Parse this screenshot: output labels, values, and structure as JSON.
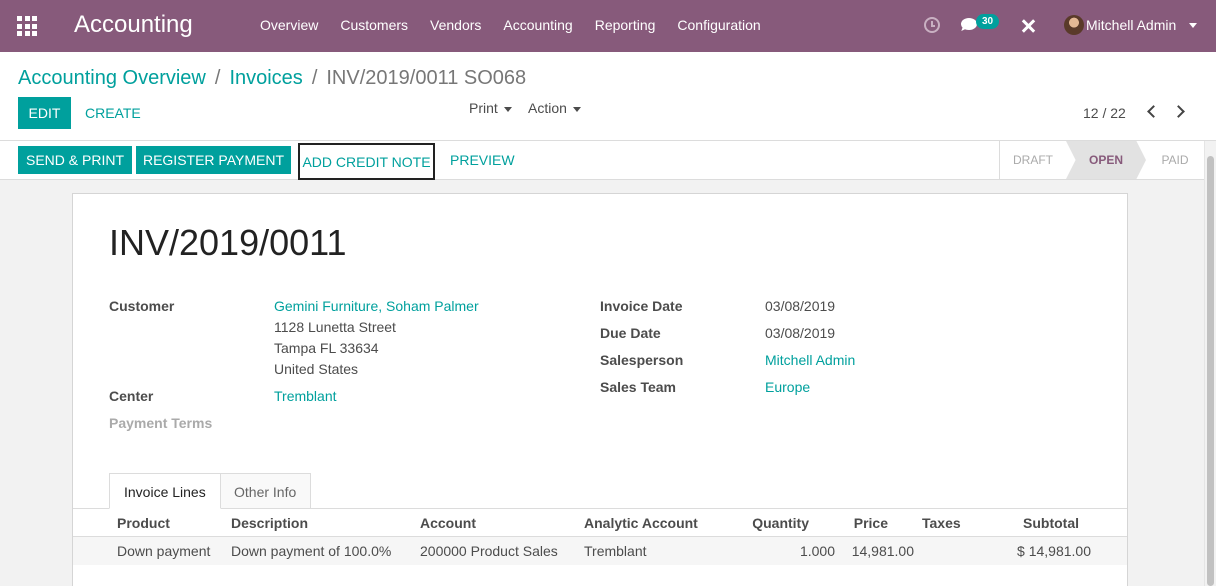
{
  "navbar": {
    "app_title": "Accounting",
    "menu": [
      "Overview",
      "Customers",
      "Vendors",
      "Accounting",
      "Reporting",
      "Configuration"
    ],
    "chat_count": "30",
    "user": "Mitchell Admin",
    "brand_color": "#875a7b",
    "accent_color": "#00a09d"
  },
  "breadcrumb": {
    "root": "Accounting Overview",
    "parent": "Invoices",
    "current": "INV/2019/0011 SO068",
    "separator": "/"
  },
  "toolbar": {
    "edit_label": "EDIT",
    "create_label": "CREATE",
    "print_label": "Print",
    "action_label": "Action",
    "pager": "12 / 22"
  },
  "statusbar": {
    "send_print": "SEND & PRINT",
    "register_payment": "REGISTER PAYMENT",
    "add_credit_note": "ADD CREDIT NOTE",
    "preview": "PREVIEW",
    "stages": [
      "DRAFT",
      "OPEN",
      "PAID"
    ],
    "active_stage": "OPEN"
  },
  "invoice": {
    "number": "INV/2019/0011",
    "customer_label": "Customer",
    "customer_name": "Gemini Furniture, Soham Palmer",
    "address": [
      "1128 Lunetta Street",
      "Tampa FL 33634",
      "United States"
    ],
    "center_label": "Center",
    "center": "Tremblant",
    "payment_terms_label": "Payment Terms",
    "invoice_date_label": "Invoice Date",
    "invoice_date": "03/08/2019",
    "due_date_label": "Due Date",
    "due_date": "03/08/2019",
    "salesperson_label": "Salesperson",
    "salesperson": "Mitchell Admin",
    "sales_team_label": "Sales Team",
    "sales_team": "Europe"
  },
  "tabs": [
    "Invoice Lines",
    "Other Info"
  ],
  "lines": {
    "headers": [
      "Product",
      "Description",
      "Account",
      "Analytic Account",
      "Quantity",
      "Price",
      "Taxes",
      "Subtotal"
    ],
    "rows": [
      {
        "product": "Down payment",
        "description": "Down payment of 100.0%",
        "account": "200000 Product Sales",
        "analytic": "Tremblant",
        "quantity": "1.000",
        "price": "14,981.00",
        "taxes": "",
        "subtotal": "$ 14,981.00"
      }
    ]
  }
}
